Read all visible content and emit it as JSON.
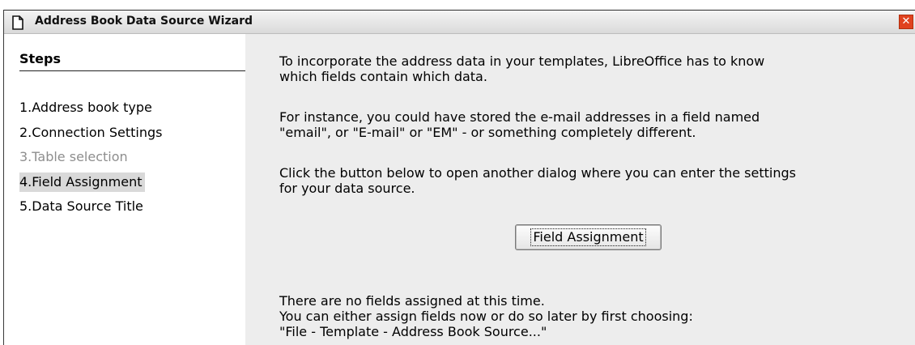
{
  "window": {
    "title": "Address Book Data Source Wizard",
    "close_glyph": "✕"
  },
  "steps": {
    "heading": "Steps",
    "items": [
      {
        "number": "1.",
        "label": "Address book type",
        "state": "normal"
      },
      {
        "number": "2.",
        "label": "Connection Settings",
        "state": "normal"
      },
      {
        "number": "3.",
        "label": "Table selection",
        "state": "disabled"
      },
      {
        "number": "4.",
        "label": "Field Assignment",
        "state": "active"
      },
      {
        "number": "5.",
        "label": "Data Source Title",
        "state": "normal"
      }
    ]
  },
  "content": {
    "intro_line1": "To incorporate the address data in your templates, LibreOffice has to know",
    "intro_line2": "which fields contain which data.",
    "example_line1": "For instance, you could have stored the e-mail addresses in a field named",
    "example_line2": "\"email\", or \"E-mail\" or \"EM\" - or something completely different.",
    "instruction_line1": "Click the button below to open another dialog where you can enter the settings",
    "instruction_line2": "for your data source.",
    "field_button_label": "Field Assignment",
    "status_line1": "There are no fields assigned at this time.",
    "status_line2": "You can either assign fields now or do so later by first choosing:",
    "status_line3": "\"File - Template - Address Book Source...\""
  },
  "icons": {
    "window_icon": "document-icon",
    "close": "close-icon"
  },
  "colors": {
    "close_button": "#e0421f",
    "content_background": "#ededed",
    "active_step": "#d9d9d9",
    "disabled_text": "#8e8e8e"
  }
}
